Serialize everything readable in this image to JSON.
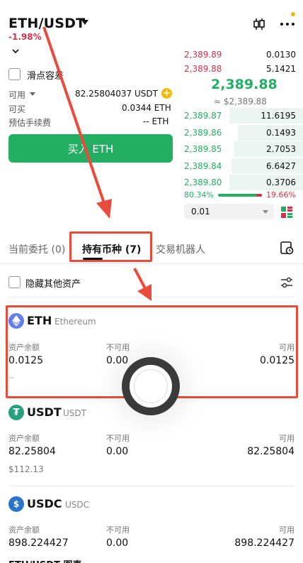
{
  "header": {
    "pair": "ETH/USDT",
    "change": "-1.98%"
  },
  "form": {
    "slippage_label": "滑点容差",
    "available_label": "可用",
    "available_value": "82.25804037 USDT",
    "can_buy_label": "可买",
    "can_buy_value": "0.0344 ETH",
    "fee_label": "预估手续费",
    "fee_value": "-- ETH",
    "buy_button": "买入 ETH"
  },
  "orderbook": {
    "asks": [
      {
        "price": "2,389.89",
        "qty": "0.0130"
      },
      {
        "price": "2,389.88",
        "qty": "5.1421"
      }
    ],
    "mid_price": "2,389.88",
    "mid_fiat": "≈ $2,389.88",
    "bids": [
      {
        "price": "2,389.87",
        "qty": "11.6195",
        "depth": 0.62
      },
      {
        "price": "2,389.86",
        "qty": "0.1493",
        "depth": 0.55
      },
      {
        "price": "2,389.85",
        "qty": "2.7053",
        "depth": 0.58
      },
      {
        "price": "2,389.84",
        "qty": "6.6427",
        "depth": 0.6
      },
      {
        "price": "2,389.80",
        "qty": "0.3706",
        "depth": 0.62
      }
    ],
    "buy_ratio": "80.34%",
    "sell_ratio": "19.66%",
    "precision": "0.01"
  },
  "tabs": {
    "open_orders": "当前委托 (0)",
    "holdings": "持有币种 (7)",
    "bots": "交易机器人"
  },
  "filter": {
    "hide_other": "隐藏其他资产"
  },
  "assets": [
    {
      "symbol": "ETH",
      "name": "Ethereum",
      "balance_label": "资产余额",
      "unavailable_label": "不可用",
      "available_label": "可用",
      "balance": "0.0125",
      "unavailable": "0.00",
      "available": "0.0125",
      "fiat": "--"
    },
    {
      "symbol": "USDT",
      "name": "USDT",
      "balance_label": "资产余额",
      "unavailable_label": "不可用",
      "available_label": "可用",
      "balance": "82.25804",
      "unavailable": "0.00",
      "available": "82.25804",
      "fiat": "$112.13"
    },
    {
      "symbol": "USDC",
      "name": "USDC",
      "balance_label": "资产余额",
      "unavailable_label": "不可用",
      "available_label": "可用",
      "balance": "898.224427",
      "unavailable": "0.00",
      "available": "898.224427"
    }
  ],
  "footer_partial": "ETH/USDT 图表",
  "colors": {
    "green": "#24ae64",
    "red": "#d4314a",
    "highlight": "#e74c3c"
  }
}
